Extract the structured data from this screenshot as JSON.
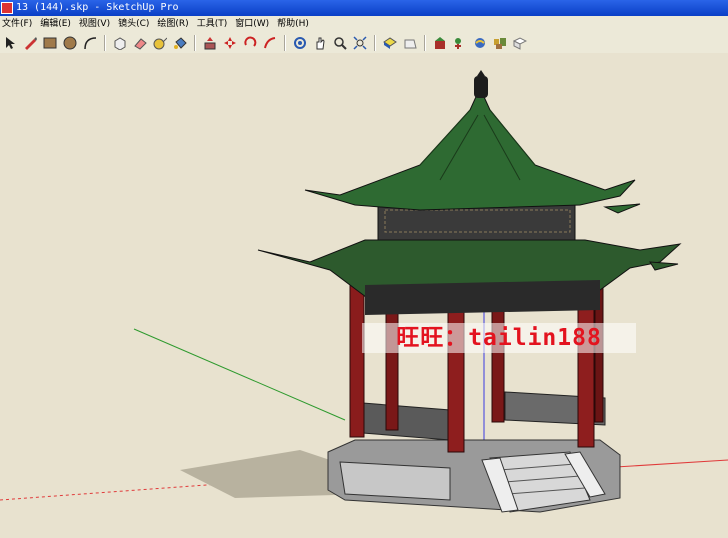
{
  "window": {
    "title": "13 (144).skp - SketchUp Pro"
  },
  "menu": [
    {
      "label": "文件(F)"
    },
    {
      "label": "编辑(E)"
    },
    {
      "label": "视图(V)"
    },
    {
      "label": "镜头(C)"
    },
    {
      "label": "绘图(R)"
    },
    {
      "label": "工具(T)"
    },
    {
      "label": "窗口(W)"
    },
    {
      "label": "帮助(H)"
    }
  ],
  "toolbar": {
    "groups": [
      [
        "select-icon",
        "pencil-icon",
        "rectangle-icon",
        "circle-icon",
        "arc-icon"
      ],
      [
        "make-component-icon",
        "eraser-icon",
        "tape-measure-icon",
        "paint-bucket-icon"
      ],
      [
        "push-pull-icon",
        "move-icon",
        "rotate-icon",
        "follow-me-icon"
      ],
      [
        "orbit-icon",
        "pan-icon",
        "zoom-icon",
        "zoom-extents-icon"
      ],
      [
        "top-view-icon",
        "front-view-icon"
      ],
      [
        "get-models-icon",
        "share-model-icon",
        "add-location-icon",
        "toggle-terrain-icon",
        "photo-texture-icon"
      ]
    ]
  },
  "viewport": {
    "background": "#e8e2cf",
    "watermark": "旺旺：tailin188",
    "axes": {
      "red": "#e03a3a",
      "green": "#2e9a2e",
      "blue": "#3a3ae0"
    }
  }
}
